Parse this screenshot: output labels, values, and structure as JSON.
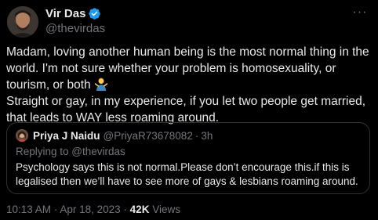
{
  "author": {
    "display_name": "Vir Das",
    "handle": "@thevirdas",
    "verified": true
  },
  "more_menu": "···",
  "tweet": {
    "line1": "Madam, loving another human being is the most normal thing in the world. I'm not sure whether your problem is homosexuality, or tourism, or both ",
    "line2": "Straight or gay, in my experience, if you let two people get married, that leads to WAY less roaming around.",
    "emoji": "person-shrugging-emoji"
  },
  "quoted": {
    "display_name": "Priya J Naidu",
    "handle": "@PriyaR73678082",
    "separator": "·",
    "time": "3h",
    "replying_prefix": "Replying to ",
    "replying_to": "@thevirdas",
    "text": "Psychology says this is not normal.Please don’t encourage this.if this is legalised then we’ll have to see more of gays & lesbians roaming around."
  },
  "meta": {
    "time": "10:13 AM",
    "separator": "·",
    "date": "Apr 18, 2023",
    "views_count": "42K",
    "views_label": "Views"
  },
  "colors": {
    "background": "#000000",
    "text": "#e7e9ea",
    "secondary": "#71767b",
    "verified": "#1d9bf0",
    "border": "#2f3336"
  }
}
